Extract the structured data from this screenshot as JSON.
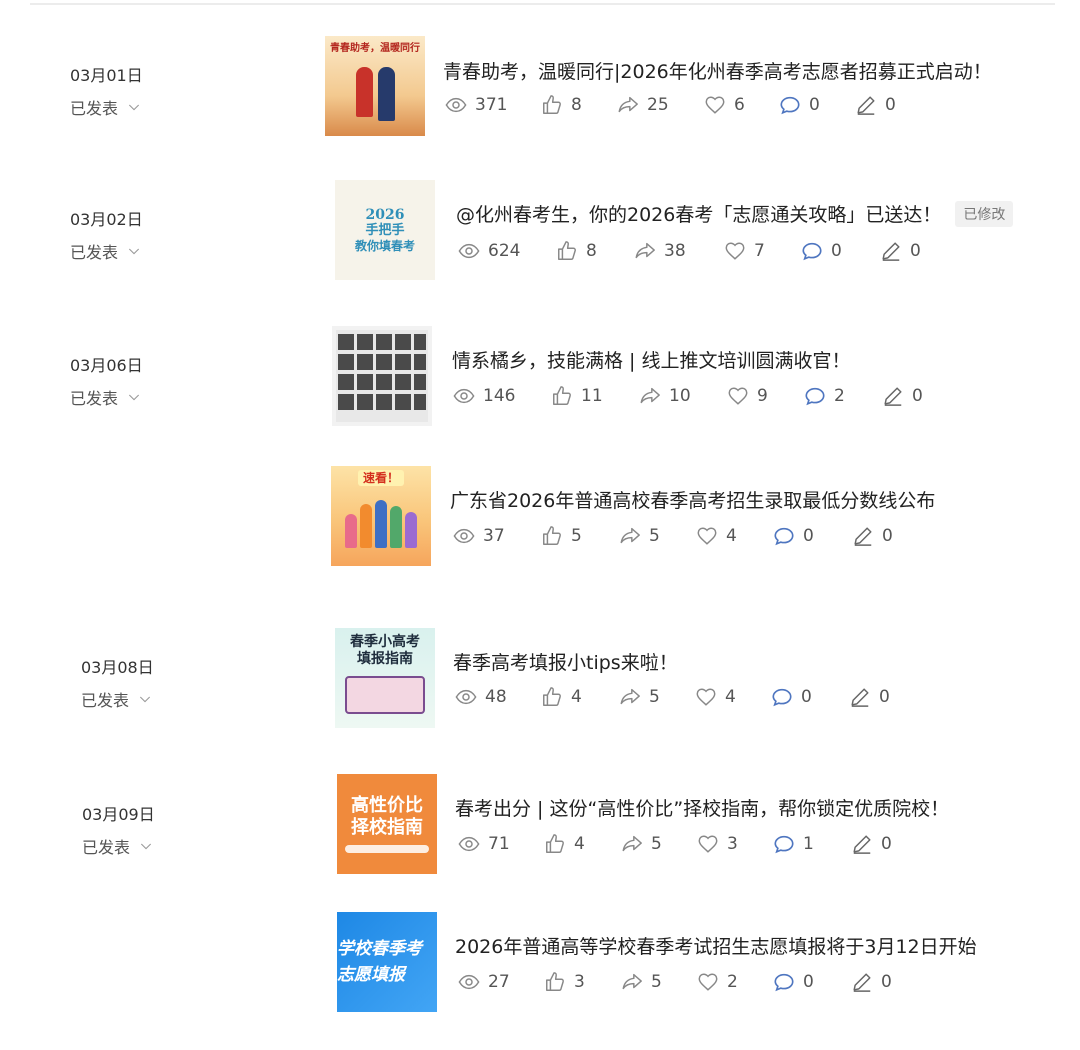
{
  "dates": [
    {
      "date": "03月01日",
      "status": "已发表"
    },
    {
      "date": "03月02日",
      "status": "已发表"
    },
    {
      "date": "03月06日",
      "status": "已发表"
    },
    {
      "date": "03月08日",
      "status": "已发表"
    },
    {
      "date": "03月09日",
      "status": "已发表"
    }
  ],
  "articles": [
    {
      "title": "青春助考，温暖同行|2026年化州春季高考志愿者招募正式启动！",
      "thumb_text": "青春助考，温暖同行",
      "stats": {
        "views": "371",
        "likes": "8",
        "shares": "25",
        "favorites": "6",
        "comments": "0",
        "notes": "0"
      }
    },
    {
      "title": "@化州春考生，你的2026春考「志愿通关攻略」已送达！",
      "badge": "已修改",
      "thumb_text_1": "2026",
      "thumb_text_2": "手把手",
      "thumb_text_3": "教你填春考",
      "stats": {
        "views": "624",
        "likes": "8",
        "shares": "38",
        "favorites": "7",
        "comments": "0",
        "notes": "0"
      }
    },
    {
      "title": "情系橘乡，技能满格 | 线上推文培训圆满收官！",
      "stats": {
        "views": "146",
        "likes": "11",
        "shares": "10",
        "favorites": "9",
        "comments": "2",
        "notes": "0"
      }
    },
    {
      "title": "广东省2026年普通高校春季高考招生录取最低分数线公布",
      "thumb_text": "速看！",
      "stats": {
        "views": "37",
        "likes": "5",
        "shares": "5",
        "favorites": "4",
        "comments": "0",
        "notes": "0"
      }
    },
    {
      "title": "春季高考填报小tips来啦！",
      "thumb_text_1": "春季小高考",
      "thumb_text_2": "填报指南",
      "stats": {
        "views": "48",
        "likes": "4",
        "shares": "5",
        "favorites": "4",
        "comments": "0",
        "notes": "0"
      }
    },
    {
      "title": "春考出分 | 这份“高性价比”择校指南，帮你锁定优质院校！",
      "thumb_text_1": "高性价比",
      "thumb_text_2": "择校指南",
      "stats": {
        "views": "71",
        "likes": "4",
        "shares": "5",
        "favorites": "3",
        "comments": "1",
        "notes": "0"
      }
    },
    {
      "title": "2026年普通高等学校春季考试招生志愿填报将于3月12日开始",
      "thumb_text_1": "学校春季考",
      "thumb_text_2": "志愿填报",
      "stats": {
        "views": "27",
        "likes": "3",
        "shares": "5",
        "favorites": "2",
        "comments": "0",
        "notes": "0"
      }
    }
  ],
  "colors": {
    "accent_blue": "#4f76c0",
    "orange": "#f08a3c",
    "icon_gray": "#8a8a8a"
  }
}
